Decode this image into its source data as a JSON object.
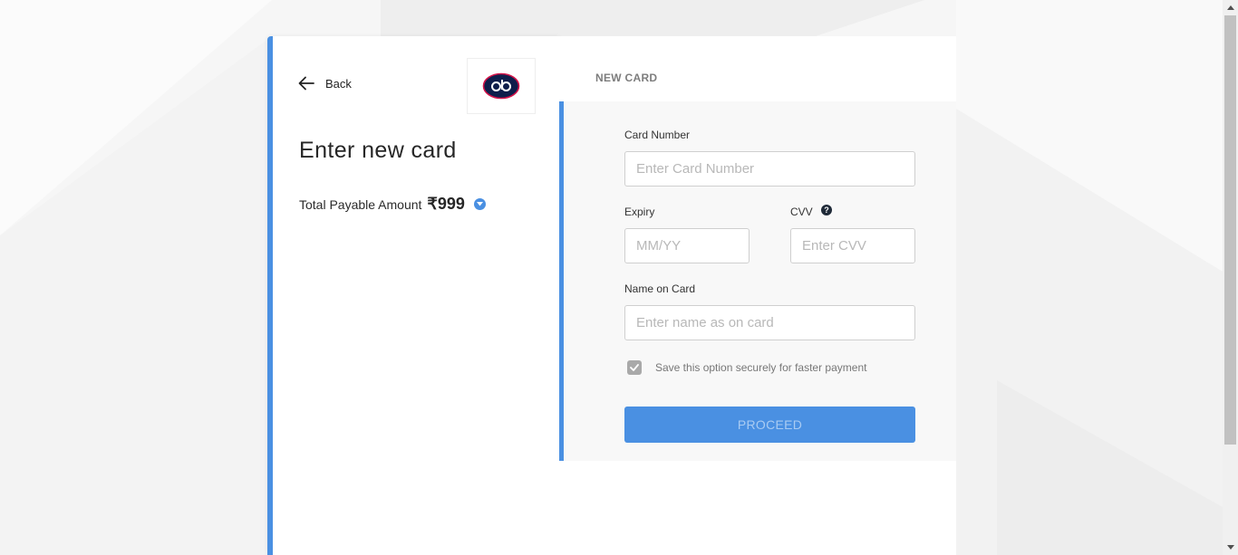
{
  "left_panel": {
    "back_label": "Back",
    "back_icon": "arrow-left-icon",
    "logo_icon": "cb-logo",
    "title": "Enter new card",
    "amount_label": "Total Payable Amount",
    "amount_value": "₹999",
    "amount_toggle_icon": "chevron-down-icon"
  },
  "right_panel": {
    "section_header": "NEW CARD",
    "card_number": {
      "label": "Card Number",
      "placeholder": "Enter Card Number",
      "value": ""
    },
    "expiry": {
      "label": "Expiry",
      "placeholder": "MM/YY",
      "value": ""
    },
    "cvv": {
      "label": "CVV",
      "placeholder": "Enter CVV",
      "value": "",
      "help_icon": "question-circle-icon",
      "help_glyph": "?"
    },
    "name_on_card": {
      "label": "Name on Card",
      "placeholder": "Enter name as on card",
      "value": ""
    },
    "save_option": {
      "label": "Save this option securely for faster payment",
      "checked": true
    },
    "proceed_label": "PROCEED"
  },
  "colors": {
    "accent": "#4a90e2",
    "proceed_text": "#a9cbf2",
    "checkbox": "#a9a9a9",
    "logo_ring": "#0e1e4b",
    "logo_accent": "#d1144a"
  }
}
